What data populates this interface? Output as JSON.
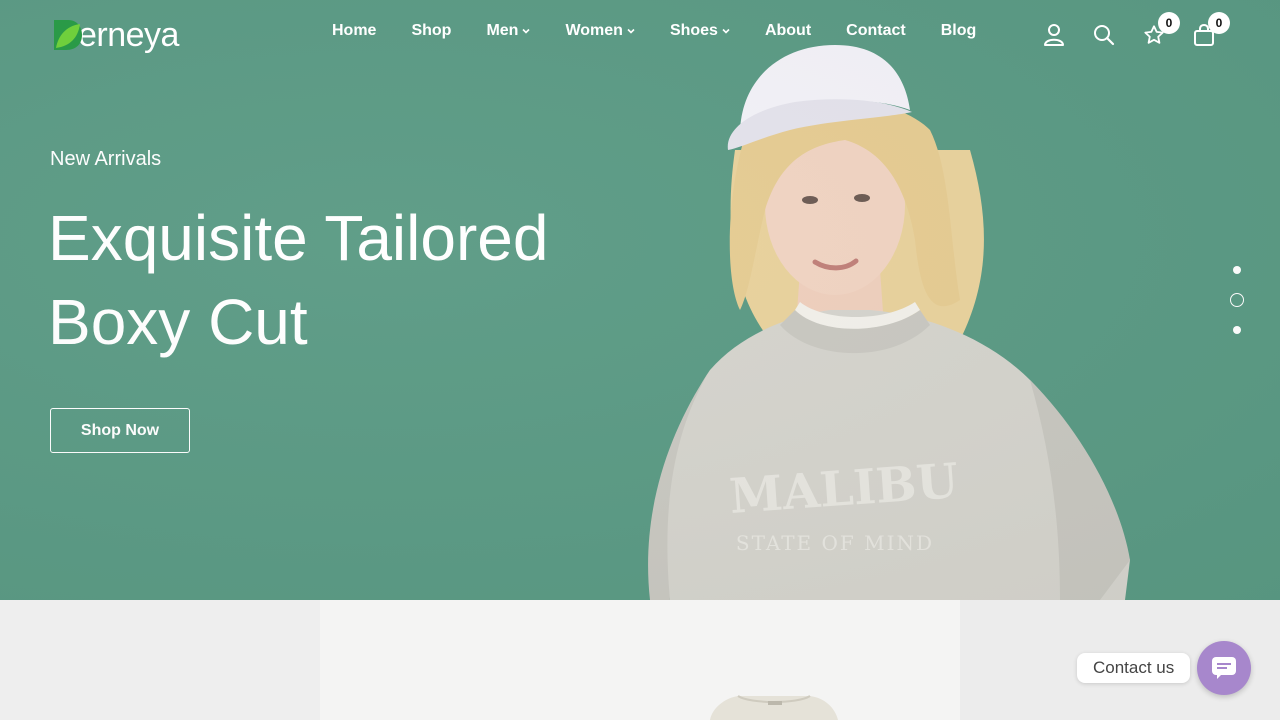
{
  "brand": {
    "name": "erneya",
    "logo_colors": [
      "#1f8a3e",
      "#5fc23a"
    ]
  },
  "nav": {
    "items": [
      {
        "label": "Home",
        "dropdown": false
      },
      {
        "label": "Shop",
        "dropdown": false
      },
      {
        "label": "Men",
        "dropdown": true
      },
      {
        "label": "Women",
        "dropdown": true
      },
      {
        "label": "Shoes",
        "dropdown": true
      },
      {
        "label": "About",
        "dropdown": false
      },
      {
        "label": "Contact",
        "dropdown": false
      },
      {
        "label": "Blog",
        "dropdown": false
      }
    ]
  },
  "header_icons": {
    "account": "user-icon",
    "search": "search-icon",
    "wishlist": "star-icon",
    "wishlist_count": "0",
    "cart": "shopping-bag-icon",
    "cart_count": "0"
  },
  "hero": {
    "eyebrow": "New Arrivals",
    "headline_line1": "Exquisite Tailored",
    "headline_line2": "Boxy Cut",
    "cta_label": "Shop Now",
    "background_color": "#5a9a84",
    "slides": 3,
    "active_slide": 2
  },
  "model_print": {
    "line1": "MALIBU",
    "line2": "STATE OF MIND"
  },
  "contact_widget": {
    "label": "Contact us",
    "color": "#a787cc",
    "icon": "chat-icon"
  }
}
